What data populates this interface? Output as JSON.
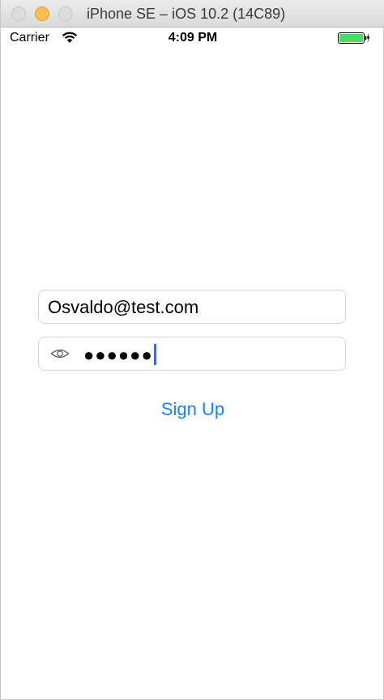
{
  "window": {
    "title": "iPhone SE – iOS 10.2 (14C89)"
  },
  "status_bar": {
    "carrier": "Carrier",
    "time": "4:09 PM",
    "wifi_icon": "wifi-icon",
    "battery_icon": "battery-charging-icon",
    "battery_color": "#4cd964"
  },
  "form": {
    "email_value": "Osvaldo@test.com",
    "password_value": "●●●●●●",
    "eye_icon": "eye-icon",
    "signup_label": "Sign Up",
    "accent_color": "#1a82f7"
  }
}
